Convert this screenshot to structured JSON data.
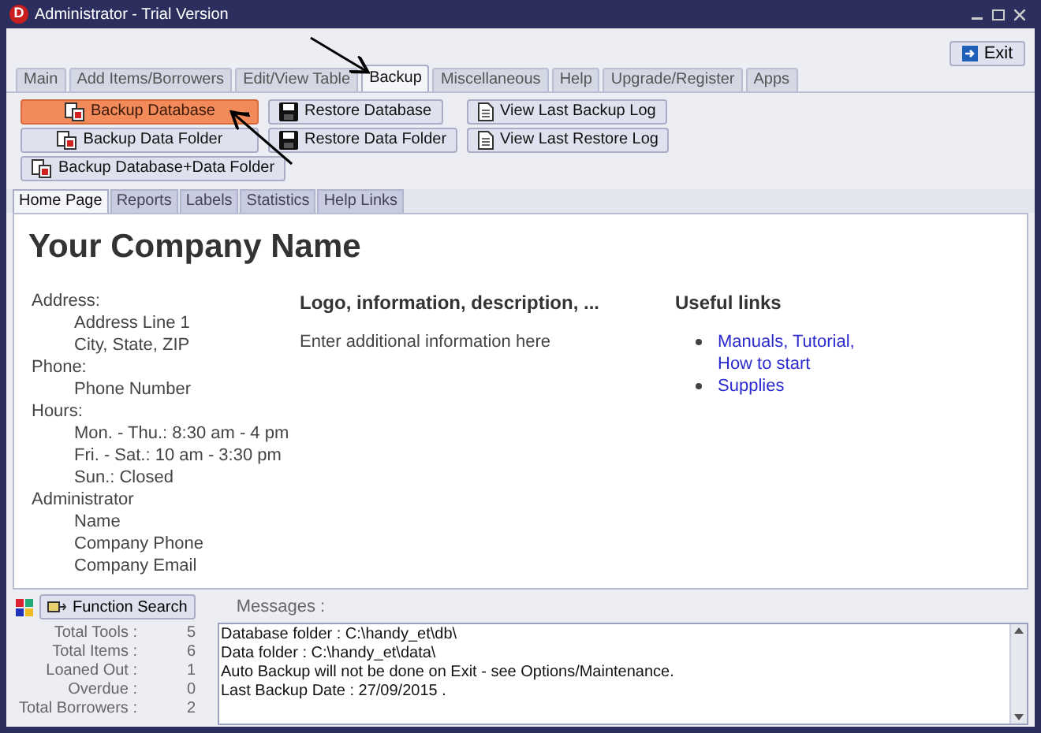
{
  "window": {
    "title": "Administrator - Trial Version",
    "logo": "D"
  },
  "exit_button": {
    "label": "Exit"
  },
  "tabs": [
    {
      "label": "Main",
      "selected": false
    },
    {
      "label": "Add Items/Borrowers",
      "selected": false
    },
    {
      "label": "Edit/View Table",
      "selected": false
    },
    {
      "label": "Backup",
      "selected": true
    },
    {
      "label": "Miscellaneous",
      "selected": false
    },
    {
      "label": "Help",
      "selected": false
    },
    {
      "label": "Upgrade/Register",
      "selected": false
    },
    {
      "label": "Apps",
      "selected": false
    }
  ],
  "button_groups": [
    [
      {
        "label": "Backup Database",
        "kind": "backup",
        "highlighted": true
      },
      {
        "label": "Backup Data Folder",
        "kind": "backup",
        "highlighted": false
      },
      {
        "label": "Backup Database+Data Folder",
        "kind": "backup",
        "highlighted": false
      }
    ],
    [
      {
        "label": "Restore Database",
        "kind": "restore",
        "highlighted": false
      },
      {
        "label": "Restore Data Folder",
        "kind": "restore",
        "highlighted": false
      }
    ],
    [
      {
        "label": "View Last Backup Log",
        "kind": "log",
        "highlighted": false
      },
      {
        "label": "View Last Restore Log",
        "kind": "log",
        "highlighted": false
      }
    ]
  ],
  "sub_tabs": [
    {
      "label": "Home Page",
      "selected": true
    },
    {
      "label": "Reports",
      "selected": false
    },
    {
      "label": "Labels",
      "selected": false
    },
    {
      "label": "Statistics",
      "selected": false
    },
    {
      "label": "Help Links",
      "selected": false
    }
  ],
  "home_page": {
    "company_name": "Your Company Name",
    "contact": [
      {
        "label": "Address:",
        "lines": [
          "Address Line 1",
          "City, State, ZIP"
        ]
      },
      {
        "label": "Phone:",
        "lines": [
          "Phone Number"
        ]
      },
      {
        "label": "Hours:",
        "lines": [
          "Mon. - Thu.: 8:30 am - 4 pm",
          "Fri. - Sat.: 10 am - 3:30 pm",
          "Sun.: Closed"
        ]
      },
      {
        "label": "Administrator",
        "lines": [
          "Name",
          "Company Phone",
          "Company Email"
        ]
      }
    ],
    "info_heading": "Logo, information, description, ...",
    "info_text": "Enter additional information here",
    "links_heading": "Useful links",
    "links": [
      [
        "Manuals, Tutorial,",
        "How to start"
      ],
      [
        "Supplies"
      ]
    ]
  },
  "function_search": {
    "label": "Function Search"
  },
  "messages_label": "Messages :",
  "stats": [
    {
      "label": "Total Tools :",
      "value": "5"
    },
    {
      "label": "Total Items :",
      "value": "6"
    },
    {
      "label": "Loaned Out :",
      "value": "1"
    },
    {
      "label": "Overdue :",
      "value": "0"
    },
    {
      "label": "Total Borrowers :",
      "value": "2"
    }
  ],
  "messages": [
    "Database folder : C:\\handy_et\\db\\",
    "Data folder : C:\\handy_et\\data\\",
    "Auto Backup will not be done on Exit - see Options/Maintenance.",
    "Last Backup Date : 27/09/2015 ."
  ]
}
